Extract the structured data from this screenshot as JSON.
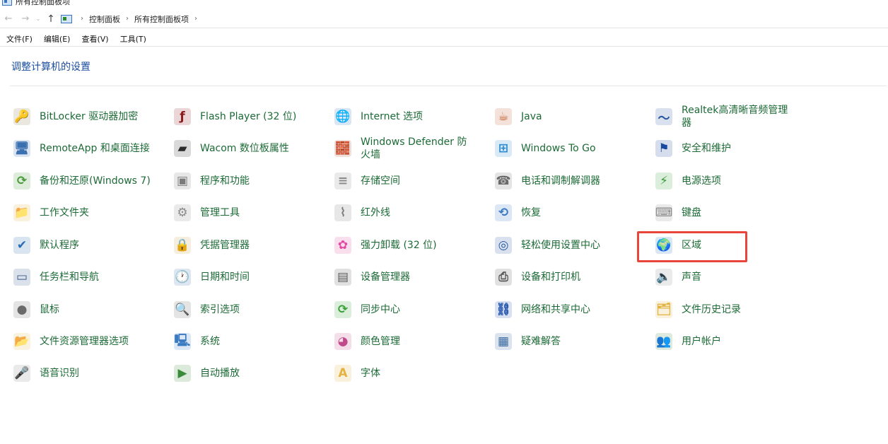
{
  "window": {
    "title": "所有控制面板项"
  },
  "nav": {
    "back_glyph": "←",
    "forward_glyph": "→",
    "dropdown_glyph": "⌄",
    "up_glyph": "↑",
    "breadcrumb": [
      "控制面板",
      "所有控制面板项"
    ],
    "sep_glyph": "›"
  },
  "menu": [
    "文件(F)",
    "编辑(E)",
    "查看(V)",
    "工具(T)"
  ],
  "heading": "调整计算机的设置",
  "columns": [
    [
      {
        "label": "BitLocker 驱动器加密",
        "icon": "key-drive-icon",
        "color": "#8a7a4a",
        "glyph": "🔑"
      },
      {
        "label": "RemoteApp 和桌面连接",
        "icon": "remote-desktop-icon",
        "color": "#3a6fb0",
        "glyph": "🖥"
      },
      {
        "label": "备份和还原(Windows 7)",
        "icon": "backup-icon",
        "color": "#4a9a3a",
        "glyph": "⟳"
      },
      {
        "label": "工作文件夹",
        "icon": "work-folder-icon",
        "color": "#e3b341",
        "glyph": "📁"
      },
      {
        "label": "默认程序",
        "icon": "default-programs-icon",
        "color": "#2b6bb3",
        "glyph": "✔"
      },
      {
        "label": "任务栏和导航",
        "icon": "taskbar-icon",
        "color": "#3a5a8a",
        "glyph": "▭"
      },
      {
        "label": "鼠标",
        "icon": "mouse-icon",
        "color": "#6a6a6a",
        "glyph": "●"
      },
      {
        "label": "文件资源管理器选项",
        "icon": "explorer-options-icon",
        "color": "#e0b84a",
        "glyph": "📂"
      },
      {
        "label": "语音识别",
        "icon": "microphone-icon",
        "color": "#8a8a8a",
        "glyph": "🎤"
      }
    ],
    [
      {
        "label": "Flash Player (32 位)",
        "icon": "flash-icon",
        "color": "#8a1a1a",
        "glyph": "ƒ"
      },
      {
        "label": "Wacom 数位板属性",
        "icon": "tablet-icon",
        "color": "#2a2a2a",
        "glyph": "▰"
      },
      {
        "label": "程序和功能",
        "icon": "programs-icon",
        "color": "#7a7a7a",
        "glyph": "▣"
      },
      {
        "label": "管理工具",
        "icon": "admin-tools-icon",
        "color": "#8a8a8a",
        "glyph": "⚙"
      },
      {
        "label": "凭据管理器",
        "icon": "credential-icon",
        "color": "#c8a050",
        "glyph": "🔒"
      },
      {
        "label": "日期和时间",
        "icon": "clock-icon",
        "color": "#4a7ab0",
        "glyph": "🕐"
      },
      {
        "label": "索引选项",
        "icon": "index-icon",
        "color": "#6a6a6a",
        "glyph": "🔍"
      },
      {
        "label": "系统",
        "icon": "system-icon",
        "color": "#3a7ac0",
        "glyph": "🖳"
      },
      {
        "label": "自动播放",
        "icon": "autoplay-icon",
        "color": "#3a8a3a",
        "glyph": "▶"
      }
    ],
    [
      {
        "label": "Internet 选项",
        "icon": "internet-icon",
        "color": "#2a7ac0",
        "glyph": "🌐"
      },
      {
        "label": "Windows Defender 防火墙",
        "icon": "firewall-icon",
        "color": "#b04a2a",
        "glyph": "🧱"
      },
      {
        "label": "存储空间",
        "icon": "storage-icon",
        "color": "#8a8a8a",
        "glyph": "≡"
      },
      {
        "label": "红外线",
        "icon": "infrared-icon",
        "color": "#7a7a7a",
        "glyph": "⌇"
      },
      {
        "label": "强力卸载 (32 位)",
        "icon": "uninstall-icon",
        "color": "#e04aa0",
        "glyph": "✿"
      },
      {
        "label": "设备管理器",
        "icon": "device-manager-icon",
        "color": "#5a5a5a",
        "glyph": "▤"
      },
      {
        "label": "同步中心",
        "icon": "sync-icon",
        "color": "#3aa03a",
        "glyph": "⟳"
      },
      {
        "label": "颜色管理",
        "icon": "color-icon",
        "color": "#c04a8a",
        "glyph": "◕"
      },
      {
        "label": "字体",
        "icon": "fonts-icon",
        "color": "#e3b341",
        "glyph": "A"
      }
    ],
    [
      {
        "label": "Java",
        "icon": "java-icon",
        "color": "#c05a2a",
        "glyph": "☕"
      },
      {
        "label": "Windows To Go",
        "icon": "windows-to-go-icon",
        "color": "#2a8ad0",
        "glyph": "⊞"
      },
      {
        "label": "电话和调制解调器",
        "icon": "phone-icon",
        "color": "#6a6a6a",
        "glyph": "☎"
      },
      {
        "label": "恢复",
        "icon": "recovery-icon",
        "color": "#3a7ac0",
        "glyph": "⟲"
      },
      {
        "label": "轻松使用设置中心",
        "icon": "ease-of-access-icon",
        "color": "#2a5aa0",
        "glyph": "◎"
      },
      {
        "label": "设备和打印机",
        "icon": "printer-icon",
        "color": "#5a5a5a",
        "glyph": "⎙"
      },
      {
        "label": "网络和共享中心",
        "icon": "network-icon",
        "color": "#2a5ab0",
        "glyph": "⛓"
      },
      {
        "label": "疑难解答",
        "icon": "troubleshoot-icon",
        "color": "#3a6aa0",
        "glyph": "▦"
      }
    ],
    [
      {
        "label": "Realtek高清晰音频管理器",
        "icon": "audio-manager-icon",
        "color": "#2a5aa0",
        "glyph": "〜"
      },
      {
        "label": "安全和维护",
        "icon": "flag-icon",
        "color": "#1a4aa0",
        "glyph": "⚑"
      },
      {
        "label": "电源选项",
        "icon": "power-icon",
        "color": "#3a9a3a",
        "glyph": "⚡"
      },
      {
        "label": "键盘",
        "icon": "keyboard-icon",
        "color": "#8a8a8a",
        "glyph": "⌨"
      },
      {
        "label": "区域",
        "icon": "region-globe-icon",
        "color": "#2a7ac0",
        "glyph": "🌍"
      },
      {
        "label": "声音",
        "icon": "speaker-icon",
        "color": "#8a8a8a",
        "glyph": "🔈"
      },
      {
        "label": "文件历史记录",
        "icon": "file-history-icon",
        "color": "#e3b341",
        "glyph": "🗂"
      },
      {
        "label": "用户帐户",
        "icon": "user-accounts-icon",
        "color": "#4a8a4a",
        "glyph": "👥"
      }
    ]
  ],
  "highlight_color": "#e8463a"
}
